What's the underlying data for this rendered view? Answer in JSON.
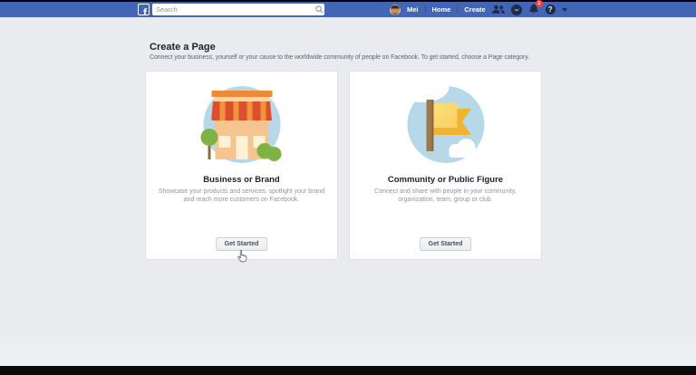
{
  "header": {
    "logo_letter": "f",
    "search_placeholder": "Search",
    "nav": {
      "profile_label": "Mei",
      "home_label": "Home",
      "create_label": "Create"
    },
    "notifications_badge": "1",
    "help_glyph": "?",
    "icons": {
      "logo": "facebook-f-logo",
      "search": "magnifier",
      "friend_requests": "two-people",
      "messenger": "chat-bolt",
      "notifications": "bell",
      "help": "question-mark-circle",
      "account_menu": "caret-down"
    },
    "colors": {
      "bar": "#4267b2",
      "icon": "#1c2b4d",
      "badge": "#fa3e3e"
    }
  },
  "page": {
    "title": "Create a Page",
    "subtitle": "Connect your business, yourself or your cause to the worldwide community of people on Facebook. To get started, choose a Page category.",
    "cards": [
      {
        "title": "Business or Brand",
        "description": "Showcase your products and services, spotlight your brand and reach more customers on Facebook.",
        "button_label": "Get Started",
        "illustration": "storefront"
      },
      {
        "title": "Community or Public Figure",
        "description": "Connect and share with people in your community, organization, team, group or club.",
        "button_label": "Get Started",
        "illustration": "flag"
      }
    ],
    "colors": {
      "background": "#e9ebee",
      "card_border": "#dddfe2",
      "illustration_circle": "#b7d8e8",
      "title_text": "#1d2129",
      "description_text": "#90949c"
    }
  }
}
